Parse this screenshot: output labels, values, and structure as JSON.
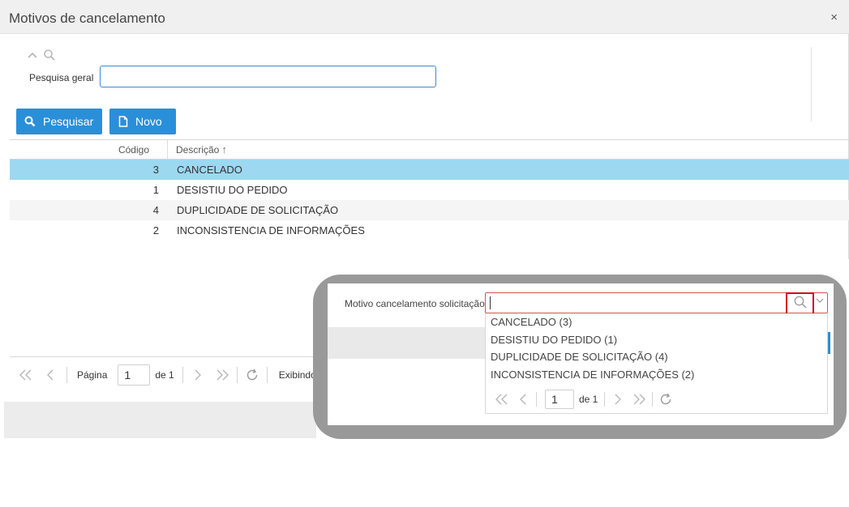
{
  "dialog": {
    "title": "Motivos de cancelamento",
    "close_glyph": "×"
  },
  "search": {
    "label": "Pesquisa geral",
    "value": "",
    "placeholder": ""
  },
  "buttons": {
    "search_label": "Pesquisar",
    "new_label": "Novo"
  },
  "grid": {
    "columns": [
      "Código",
      "Descrição"
    ],
    "sort_indicator": "↑",
    "rows": [
      {
        "codigo": "3",
        "descricao": "CANCELADO",
        "selected": true
      },
      {
        "codigo": "1",
        "descricao": "DESISTIU DO PEDIDO",
        "selected": false
      },
      {
        "codigo": "4",
        "descricao": "DUPLICIDADE DE SOLICITAÇÃO",
        "selected": false
      },
      {
        "codigo": "2",
        "descricao": "INCONSISTENCIA DE INFORMAÇÕES",
        "selected": false
      }
    ]
  },
  "pager": {
    "page_label": "Página",
    "page_value": "1",
    "of_label": "de 1",
    "showing_label": "Exibindo"
  },
  "overlay": {
    "field_label": "Motivo cancelamento solicitação",
    "field_value": "",
    "options": [
      "CANCELADO (3)",
      "DESISTIU DO PEDIDO (1)",
      "DUPLICIDADE DE SOLICITAÇÃO (4)",
      "INCONSISTENCIA DE INFORMAÇÕES (2)"
    ],
    "pager": {
      "page_value": "1",
      "of_label": "de 1"
    }
  },
  "colors": {
    "accent": "#2a8fd9",
    "selected_row": "#9dd8f1",
    "highlight_border": "#d0021b",
    "overlay_frame": "#999999"
  },
  "icons": [
    "chevron-up-icon",
    "search-icon",
    "file-icon",
    "first-page-icon",
    "prev-page-icon",
    "next-page-icon",
    "last-page-icon",
    "refresh-icon",
    "chevron-down-icon",
    "close-icon"
  ]
}
